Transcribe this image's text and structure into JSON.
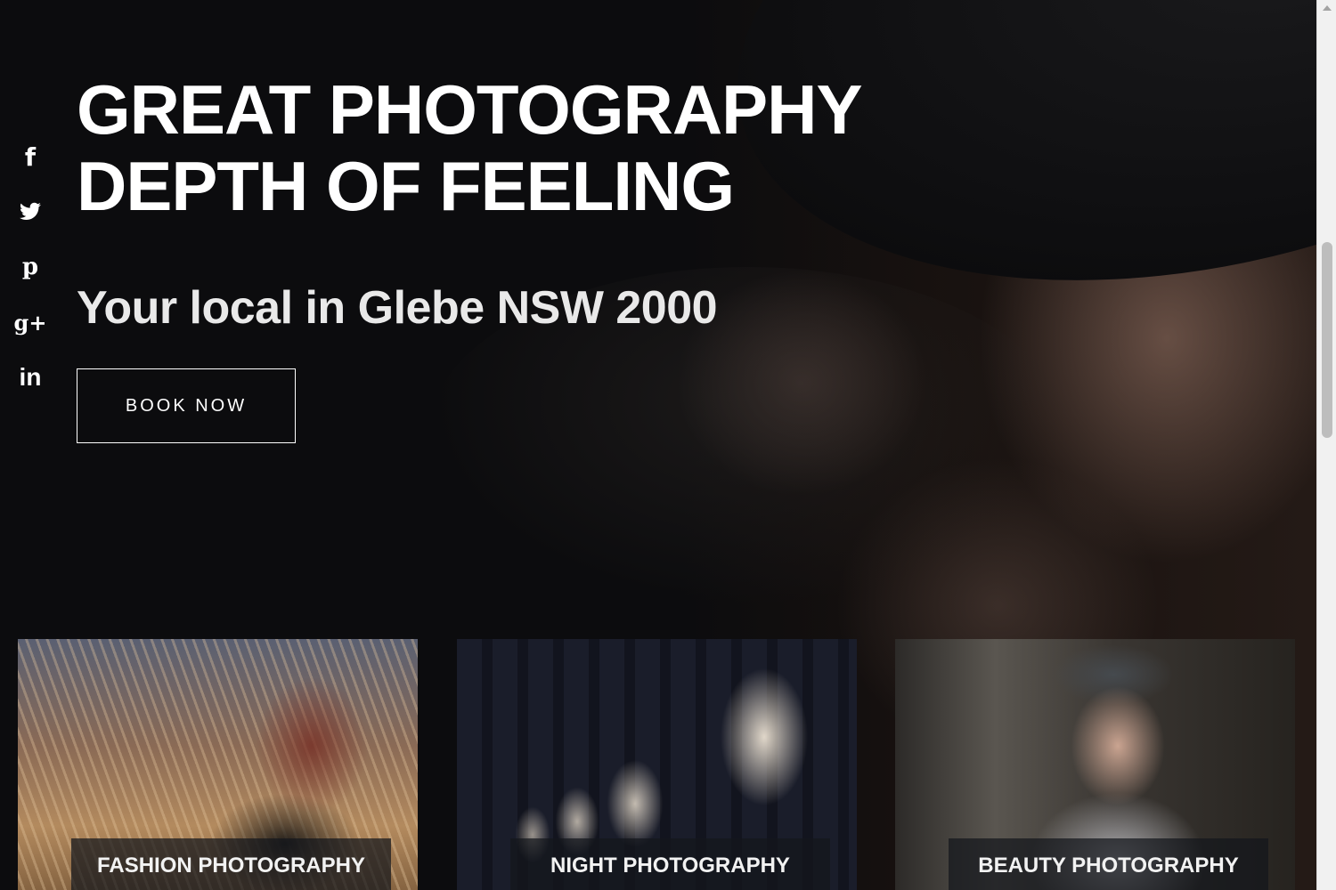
{
  "hero": {
    "title_line1": "GREAT PHOTOGRAPHY",
    "title_line2": "DEPTH OF FEELING",
    "subtitle": "Your local in Glebe NSW 2000",
    "cta_label": "BOOK NOW"
  },
  "social": {
    "items": [
      {
        "name": "facebook",
        "icon": "facebook-icon",
        "glyph": "f"
      },
      {
        "name": "twitter",
        "icon": "twitter-icon"
      },
      {
        "name": "pinterest",
        "icon": "pinterest-icon",
        "glyph": "p"
      },
      {
        "name": "google-plus",
        "icon": "google-plus-icon",
        "glyph": "g+"
      },
      {
        "name": "linkedin",
        "icon": "linkedin-icon",
        "glyph": "in"
      }
    ]
  },
  "cards": [
    {
      "label": "FASHION PHOTOGRAPHY"
    },
    {
      "label": "NIGHT PHOTOGRAPHY"
    },
    {
      "label": "BEAUTY PHOTOGRAPHY"
    }
  ]
}
